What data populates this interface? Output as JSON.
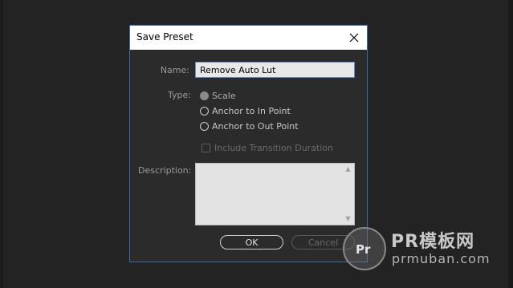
{
  "dialog": {
    "title": "Save Preset",
    "name_label": "Name:",
    "name_value": "Remove Auto Lut",
    "type_label": "Type:",
    "type_options": [
      {
        "label": "Scale",
        "selected": true
      },
      {
        "label": "Anchor to In Point",
        "selected": false
      },
      {
        "label": "Anchor to Out Point",
        "selected": false
      }
    ],
    "include_transition_label": "Include Transition Duration",
    "include_transition_checked": false,
    "description_label": "Description:",
    "description_value": "",
    "ok_label": "OK",
    "cancel_label": "Cancel"
  },
  "watermark": {
    "logo_text": "Pr",
    "brand": "PR模板网",
    "url": "prmuban.com"
  },
  "colors": {
    "background": "#232323",
    "dialog_bg": "#2b2b2b",
    "dialog_border": "#3b6ea8",
    "input_focus_border": "#5b8fc9"
  }
}
